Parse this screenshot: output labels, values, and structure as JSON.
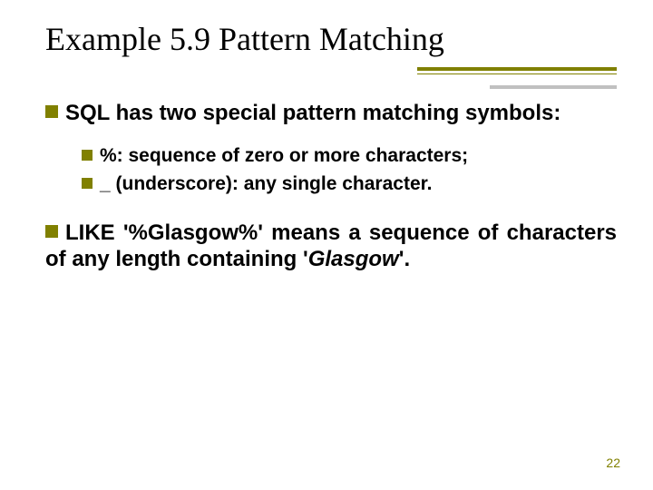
{
  "title": "Example 5.9  Pattern Matching",
  "bullets": [
    {
      "text_before": "SQL has two special pattern matching symbols:",
      "sub": [
        "%: sequence of zero or more characters;",
        "_ (underscore): any single character."
      ]
    },
    {
      "parts": [
        {
          "t": "LIKE '%Glasgow%' means a sequence of characters of any length containing '",
          "i": false
        },
        {
          "t": "Glasgow",
          "i": true
        },
        {
          "t": "'.",
          "i": false
        }
      ]
    }
  ],
  "page_number": "22"
}
